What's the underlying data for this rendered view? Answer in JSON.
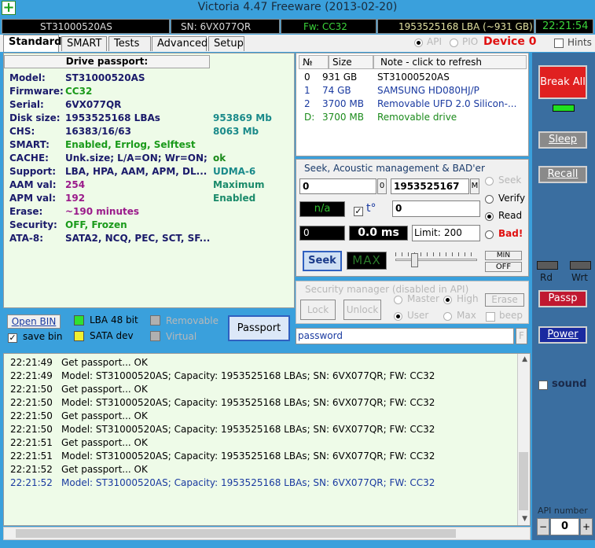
{
  "app": {
    "title": "Victoria 4.47  Freeware (2013-02-20)",
    "icon": "plus-icon"
  },
  "status": {
    "model": "ST31000520AS",
    "sn": "SN: 6VX077QR",
    "fw": "Fw: CC32",
    "lba": "1953525168 LBA (~931 GB)",
    "time": "22:21:54"
  },
  "tabs": [
    "Standard",
    "SMART",
    "Tests",
    "Advanced",
    "Setup"
  ],
  "mode": {
    "api": "API",
    "pio": "PIO",
    "device": "Device 0",
    "hints": "Hints"
  },
  "passport": {
    "header": "Drive passport:",
    "rows": [
      {
        "label": "Model:",
        "value": "ST31000520AS",
        "extra": "",
        "color": "#1a1a6a"
      },
      {
        "label": "Firmware:",
        "value": "CC32",
        "extra": "",
        "color": "#1a9a1a"
      },
      {
        "label": "Serial:",
        "value": "6VX077QR",
        "extra": "",
        "color": "#1a1a6a"
      },
      {
        "label": "Disk size:",
        "value": "1953525168 LBAs",
        "extra": "953869 Mb",
        "color": "#1a1a6a"
      },
      {
        "label": "CHS:",
        "value": "16383/16/63",
        "extra": "8063 Mb",
        "color": "#1a1a6a"
      },
      {
        "label": "SMART:",
        "value": "Enabled, Errlog, Selftest",
        "extra": "",
        "color": "#1a9a1a"
      },
      {
        "label": "CACHE:",
        "value": "Unk.size; L/A=ON; Wr=ON;",
        "extra": "ok",
        "color": "#1a1a6a"
      },
      {
        "label": "Support:",
        "value": "LBA, HPA, AAM, APM, DL...",
        "extra": "UDMA-6",
        "color": "#1a1a6a"
      },
      {
        "label": "AAM val:",
        "value": "254",
        "extra": "Maximum",
        "color": "#9a1a8a"
      },
      {
        "label": "APM val:",
        "value": "192",
        "extra": "Enabled",
        "color": "#9a1a8a"
      },
      {
        "label": "Erase:",
        "value": "~190 minutes",
        "extra": "",
        "color": "#9a1a8a"
      },
      {
        "label": "Security:",
        "value": "OFF, Frozen",
        "extra": "",
        "color": "#1a9a1a"
      },
      {
        "label": "ATA-8:",
        "value": "SATA2, NCQ, PEC, SCT, SF...",
        "extra": "",
        "color": "#1a1a6a"
      }
    ],
    "open_bin": "Open BIN",
    "save_bin": "save bin",
    "lba48": "LBA 48 bit",
    "sata": "SATA dev",
    "removable": "Removable",
    "virtual": "Virtual",
    "passport_btn": "Passport"
  },
  "drives": {
    "headers": [
      "№",
      "Size",
      "Note - click to refresh"
    ],
    "rows": [
      {
        "n": "0",
        "size": "931 GB",
        "note": "ST31000520AS",
        "color": "#000000"
      },
      {
        "n": "1",
        "size": "74 GB",
        "note": "SAMSUNG HD080HJ/P",
        "color": "#1a3aa0"
      },
      {
        "n": "2",
        "size": "3700 MB",
        "note": "Removable UFD 2.0 Silicon-...",
        "color": "#1a3aa0"
      },
      {
        "n": "D:",
        "size": "3700 MB",
        "note": "Removable drive",
        "color": "#1a8a1a"
      }
    ]
  },
  "seek": {
    "title": "Seek, Acoustic management & BAD'er",
    "from": "0",
    "from_btn": "0",
    "to": "1953525167",
    "to_btn": "M",
    "na": "n/a",
    "t_label": "t°",
    "value": "0",
    "counter": "0",
    "ms": "0.0 ms",
    "limit_label": "Limit:",
    "limit": "200",
    "seek_btn": "Seek",
    "max_display": "MAX",
    "min_btn": "MIN",
    "off_btn": "OFF",
    "opt_seek": "Seek",
    "opt_verify": "Verify",
    "opt_read": "Read",
    "opt_bad": "Bad!"
  },
  "security": {
    "title": "Security manager (disabled in API)",
    "lock": "Lock",
    "unlock": "Unlock",
    "master": "Master",
    "high": "High",
    "user": "User",
    "max": "Max",
    "erase": "Erase",
    "beep": "beep",
    "password": "password",
    "f_btn": "F"
  },
  "right": {
    "break_all": "Break All",
    "sleep": "Sleep",
    "recall": "Recall",
    "rd": "Rd",
    "wrt": "Wrt",
    "passp": "Passp",
    "power": "Power",
    "sound": "sound",
    "api_number_label": "API number",
    "api_number": "0",
    "minus": "−",
    "plus": "+"
  },
  "log": [
    {
      "time": "22:21:49",
      "msg": "Get passport... OK",
      "blue": false
    },
    {
      "time": "22:21:49",
      "msg": "Model: ST31000520AS; Capacity: 1953525168 LBAs; SN: 6VX077QR; FW: CC32",
      "blue": false
    },
    {
      "time": "22:21:50",
      "msg": "Get passport... OK",
      "blue": false
    },
    {
      "time": "22:21:50",
      "msg": "Model: ST31000520AS; Capacity: 1953525168 LBAs; SN: 6VX077QR; FW: CC32",
      "blue": false
    },
    {
      "time": "22:21:50",
      "msg": "Get passport... OK",
      "blue": false
    },
    {
      "time": "22:21:50",
      "msg": "Model: ST31000520AS; Capacity: 1953525168 LBAs; SN: 6VX077QR; FW: CC32",
      "blue": false
    },
    {
      "time": "22:21:51",
      "msg": "Get passport... OK",
      "blue": false
    },
    {
      "time": "22:21:51",
      "msg": "Model: ST31000520AS; Capacity: 1953525168 LBAs; SN: 6VX077QR; FW: CC32",
      "blue": false
    },
    {
      "time": "22:21:52",
      "msg": "Get passport... OK",
      "blue": false
    },
    {
      "time": "22:21:52",
      "msg": "Model: ST31000520AS; Capacity: 1953525168 LBAs; SN: 6VX077QR; FW: CC32",
      "blue": true
    }
  ]
}
